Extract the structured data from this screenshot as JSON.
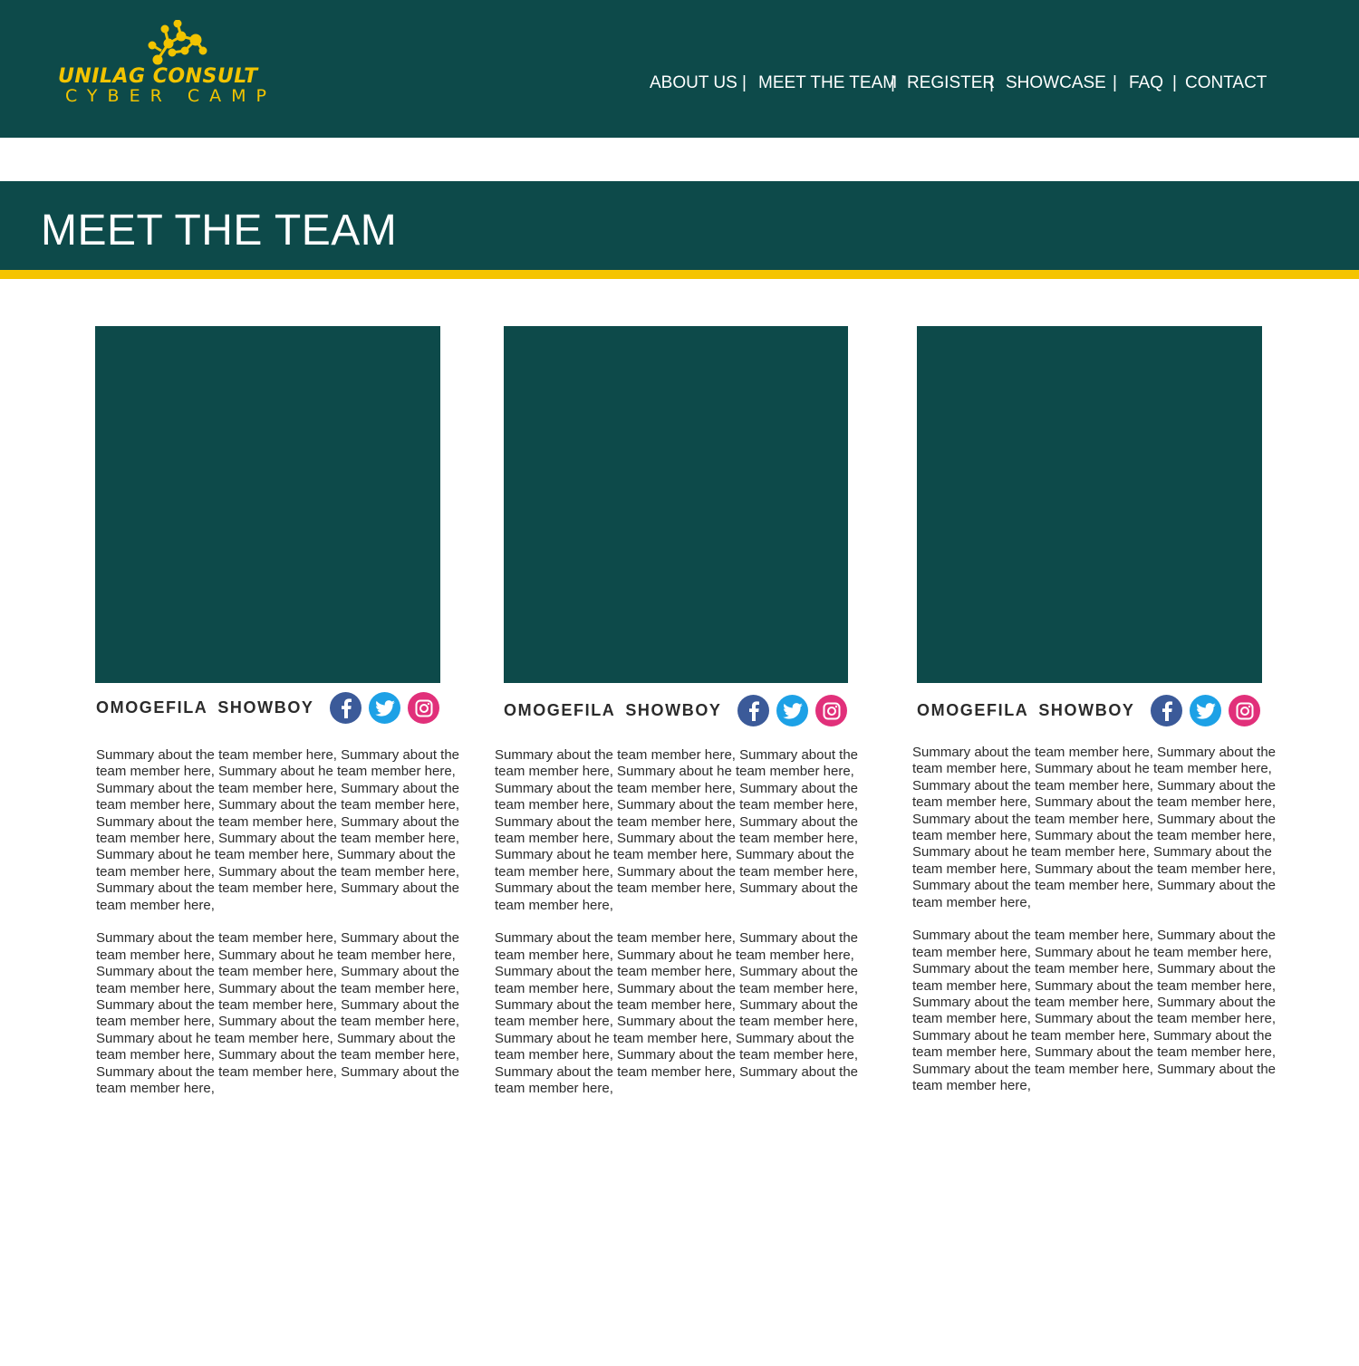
{
  "header": {
    "logo": {
      "line1": "UNILAG CONSULT",
      "line2": "CYBER CAMP",
      "color": "#f2c400"
    },
    "nav": [
      {
        "label": "ABOUT US"
      },
      {
        "label": "MEET THE TEAM"
      },
      {
        "label": "REGISTER"
      },
      {
        "label": "SHOWCASE"
      },
      {
        "label": "FAQ"
      },
      {
        "label": "CONTACT"
      }
    ],
    "separator": "|",
    "background": "#0d4a4a"
  },
  "banner": {
    "title": "MEET THE TEAM",
    "stripe_color": "#f5c400"
  },
  "team": [
    {
      "name": "OMOGEFILA SHOWBOY",
      "socials": [
        "facebook-icon",
        "twitter-icon",
        "instagram-icon"
      ],
      "bio": [
        "Summary about the team member here, Summary about the team member here, Summary about he team member here, Summary about the team member here, Summary about the team member here, Summary about the team member here, Summary about the team member here, Summary about the team member here, Summary about the team member here, Summary about he team member here, Summary about the team member here, Summary about the team member here, Summary about the team member here, Summary about the team member here,",
        "Summary about the team member here, Summary about the team member here, Summary about he team member here, Summary about the team member here, Summary about the team member here, Summary about the team member here, Summary about the team member here, Summary about the team member here, Summary about the team member here, Summary about he team member here, Summary about the team member here, Summary about the team member here, Summary about the team member here, Summary about the team member here,"
      ]
    },
    {
      "name": "OMOGEFILA SHOWBOY",
      "socials": [
        "facebook-icon",
        "twitter-icon",
        "instagram-icon"
      ],
      "bio": [
        "Summary about the team member here, Summary about the team member here, Summary about he team member here, Summary about the team member here, Summary about the team member here, Summary about the team member here, Summary about the team member here, Summary about the team member here, Summary about the team member here, Summary about he team member here, Summary about the team member here, Summary about the team member here, Summary about the team member here, Summary about the team member here,",
        "Summary about the team member here, Summary about the team member here, Summary about he team member here, Summary about the team member here, Summary about the team member here, Summary about the team member here, Summary about the team member here, Summary about the team member here, Summary about the team member here, Summary about he team member here, Summary about the team member here, Summary about the team member here, Summary about the team member here, Summary about the team member here,"
      ]
    },
    {
      "name": "OMOGEFILA SHOWBOY",
      "socials": [
        "facebook-icon",
        "twitter-icon",
        "instagram-icon"
      ],
      "bio": [
        "Summary about the team member here, Summary about the team member here, Summary about he team member here, Summary about the team member here, Summary about the team member here, Summary about the team member here, Summary about the team member here, Summary about the team member here, Summary about the team member here, Summary about he team member here, Summary about the team member here, Summary about the team member here, Summary about the team member here, Summary about the team member here,",
        "Summary about the team member here, Summary about the team member here, Summary about he team member here, Summary about the team member here, Summary about the team member here, Summary about the team member here, Summary about the team member here, Summary about the team member here, Summary about the team member here, Summary about he team member here, Summary about the team member here, Summary about the team member here, Summary about the team member here, Summary about the team member here,"
      ]
    }
  ]
}
